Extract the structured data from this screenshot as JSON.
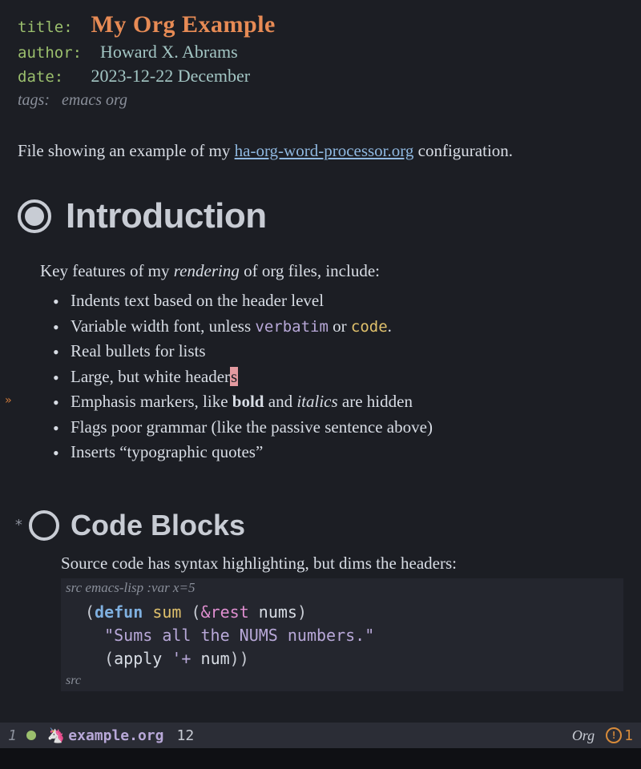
{
  "meta": {
    "title_key": "title",
    "title_value": "My Org Example",
    "author_key": "author",
    "author_value": "Howard X. Abrams",
    "date_key": "date",
    "date_value": "2023-12-22 December",
    "tags_key": "tags:",
    "tags_value": "emacs org"
  },
  "intro": {
    "before_link": "File showing an example of my ",
    "link_text": "ha-org-word-processor.org",
    "after_link": " configuration."
  },
  "h1": "Introduction",
  "features_intro_a": "Key features of my ",
  "features_intro_em": "rendering",
  "features_intro_b": " of org files, include:",
  "features": {
    "f0": "Indents text based on the header level",
    "f1a": "Variable width font, unless ",
    "f1_verbatim": "verbatim",
    "f1b": " or ",
    "f1_code": "code",
    "f1c": ".",
    "f2": "Real bullets for lists",
    "f3a": "Large, but white header",
    "f3_cursor": "s",
    "f4a": "Emphasis markers, like ",
    "f4_bold": "bold",
    "f4b": " and ",
    "f4_italics": "italics",
    "f4c": " are hidden",
    "f5": "Flags poor grammar (like the passive sentence above)",
    "f6": "Inserts “typographic quotes”"
  },
  "h2": "Code Blocks",
  "src_intro": "Source code has syntax highlighting, but dims the headers:",
  "src": {
    "header_kw": "src",
    "header_rest": " emacs-lisp :var x=5",
    "line1_open": "(",
    "line1_defun": "defun",
    "line1_sp": " ",
    "line1_name": "sum",
    "line1_args_open": " (",
    "line1_amp": "&rest",
    "line1_argsp": " ",
    "line1_arg": "nums",
    "line1_close": ")",
    "line2_doc": "\"Sums all the NUMS numbers.\"",
    "line3_open": "(",
    "line3_apply": "apply ",
    "line3_quote": "'+",
    "line3_sp": " ",
    "line3_arg": "num",
    "line3_close": "))",
    "footer": "src"
  },
  "modeline": {
    "window": "1",
    "filename": "example.org",
    "line": "12",
    "mode": "Org",
    "warn_count": "1"
  }
}
